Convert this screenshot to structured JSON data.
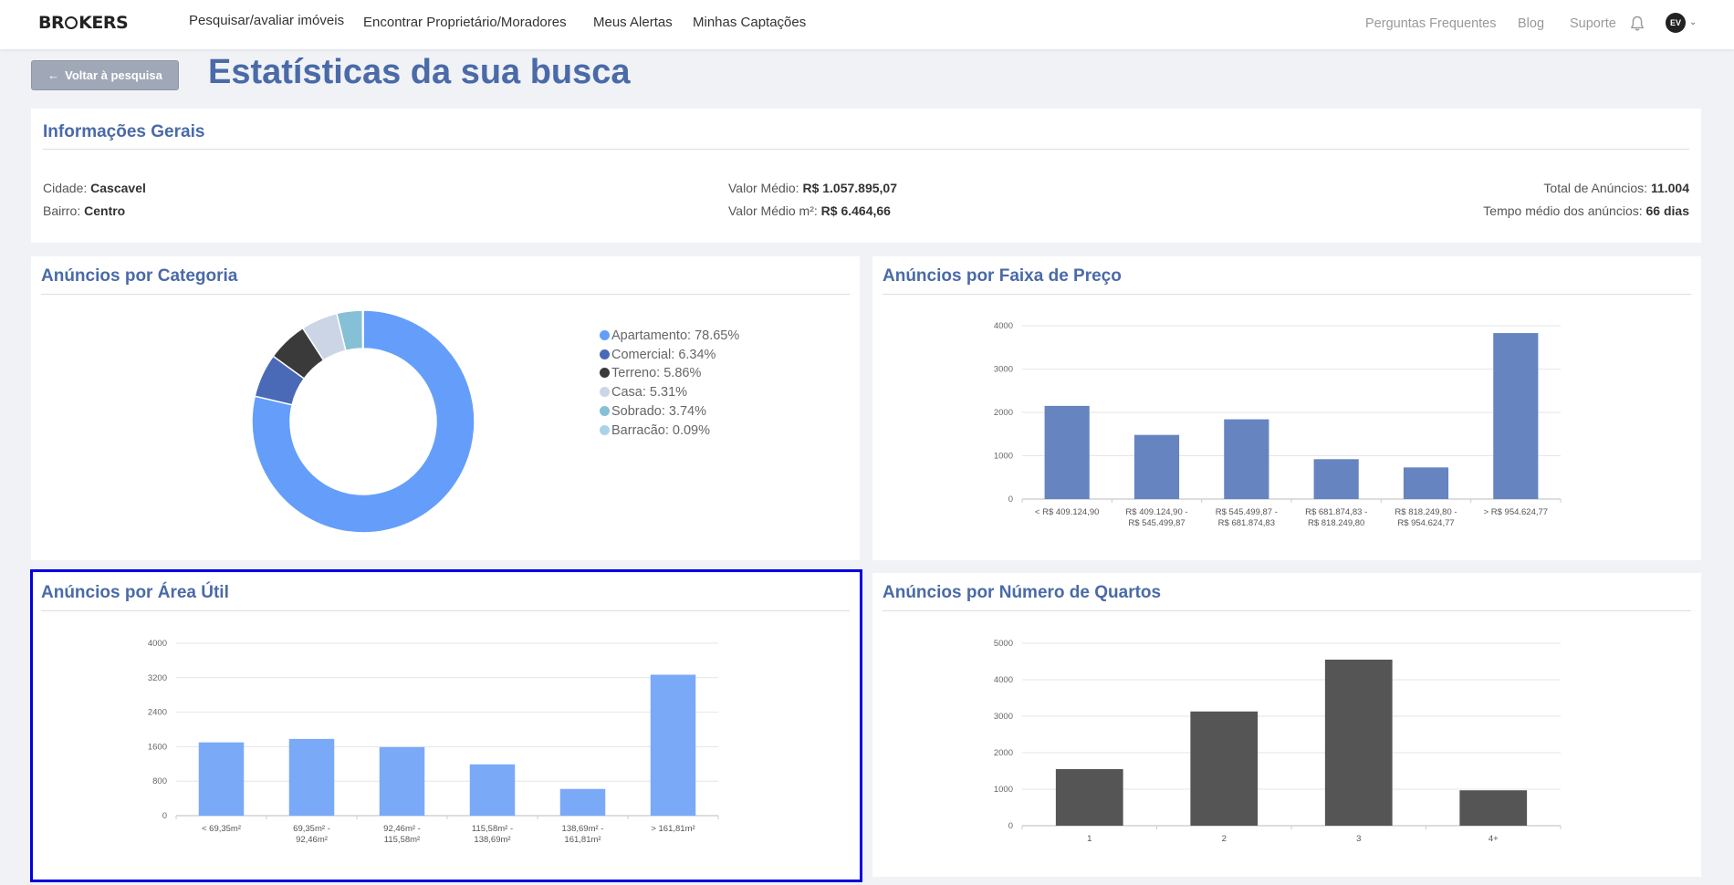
{
  "nav": {
    "logo": "BR KERS",
    "links": [
      "Pesquisar/avaliar imóveis",
      "Encontrar Proprietário/Moradores",
      "Meus Alertas",
      "Minhas Captações"
    ],
    "right_links": [
      "Perguntas Frequentes",
      "Blog",
      "Suporte"
    ],
    "avatar": "EV"
  },
  "header": {
    "back_label": "Voltar à pesquisa",
    "title": "Estatísticas da sua busca"
  },
  "info": {
    "title": "Informações Gerais",
    "cidade_label": "Cidade:",
    "cidade": "Cascavel",
    "bairro_label": "Bairro:",
    "bairro": "Centro",
    "valor_medio_label": "Valor Médio:",
    "valor_medio": "R$ 1.057.895,07",
    "valor_m2_label": "Valor Médio m²:",
    "valor_m2": "R$ 6.464,66",
    "total_label": "Total de Anúncios:",
    "total": "11.004",
    "tempo_label": "Tempo médio dos anúncios:",
    "tempo": "66 dias"
  },
  "cards": {
    "categoria": "Anúncios por Categoria",
    "preco": "Anúncios por Faixa de Preço",
    "area": "Anúncios por Área Útil",
    "quartos": "Anúncios por Número de Quartos"
  },
  "chart_data": [
    {
      "type": "pie",
      "name": "categoria",
      "categories": [
        "Apartamento",
        "Comercial",
        "Terreno",
        "Casa",
        "Sobrado",
        "Barracão"
      ],
      "values": [
        78.65,
        6.34,
        5.86,
        5.31,
        3.74,
        0.09
      ],
      "labels": [
        "Apartamento: 78.65%",
        "Comercial: 6.34%",
        "Terreno: 5.86%",
        "Casa: 5.31%",
        "Sobrado: 3.74%",
        "Barracão: 0.09%"
      ],
      "colors": [
        "#649efa",
        "#4a6ab8",
        "#3a3a3a",
        "#cbd5e6",
        "#86c0d6",
        "#a9d4e8"
      ],
      "legend": "right"
    },
    {
      "type": "bar",
      "name": "preco",
      "categories": [
        [
          "< R$ 409.124,90"
        ],
        [
          "R$ 409.124,90 -",
          "R$ 545.499,87"
        ],
        [
          "R$ 545.499,87 -",
          "R$ 681.874,83"
        ],
        [
          "R$ 681.874,83 -",
          "R$ 818.249,80"
        ],
        [
          "R$ 818.249,80 -",
          "R$ 954.624,77"
        ],
        [
          "> R$ 954.624,77"
        ]
      ],
      "values": [
        2150,
        1480,
        1840,
        920,
        730,
        3830
      ],
      "yticks": [
        0,
        1000,
        2000,
        3000,
        4000
      ],
      "ylim": [
        0,
        4000
      ],
      "color": "#6584c0",
      "grid": true
    },
    {
      "type": "bar",
      "name": "area",
      "categories": [
        [
          "< 69,35m²"
        ],
        [
          "69,35m² -",
          "92,46m²"
        ],
        [
          "92,46m² -",
          "115,58m²"
        ],
        [
          "115,58m² -",
          "138,69m²"
        ],
        [
          "138,69m² -",
          "161,81m²"
        ],
        [
          "> 161,81m²"
        ]
      ],
      "values": [
        1700,
        1780,
        1590,
        1190,
        620,
        3270
      ],
      "yticks": [
        0,
        800,
        1600,
        2400,
        3200,
        4000
      ],
      "ylim": [
        0,
        4000
      ],
      "color": "#7aa9f8",
      "grid": true
    },
    {
      "type": "bar",
      "name": "quartos",
      "categories": [
        [
          "1"
        ],
        [
          "2"
        ],
        [
          "3"
        ],
        [
          "4+"
        ]
      ],
      "values": [
        1550,
        3130,
        4550,
        970
      ],
      "yticks": [
        0,
        1000,
        2000,
        3000,
        4000,
        5000
      ],
      "ylim": [
        0,
        5000
      ],
      "color": "#555555",
      "grid": true
    }
  ]
}
